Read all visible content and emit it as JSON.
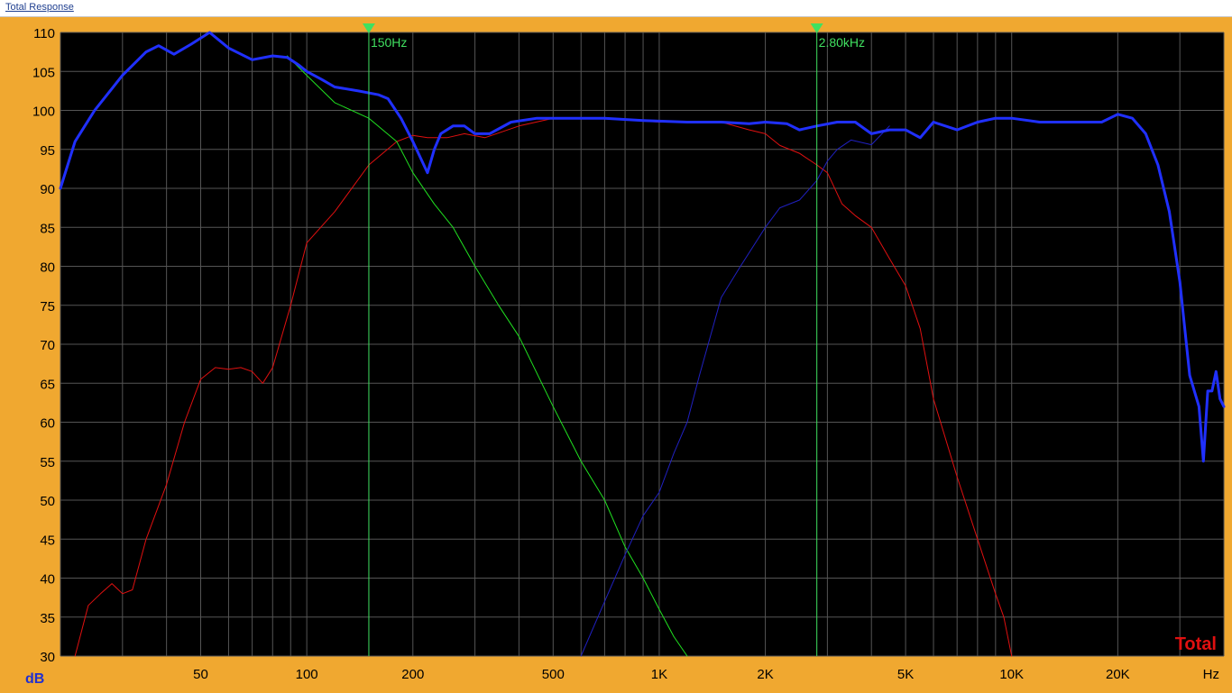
{
  "window": {
    "title": "Total Response"
  },
  "chart_data": {
    "type": "line",
    "title": "",
    "xlabel": "Hz",
    "ylabel": "dB",
    "x_scale": "log",
    "xlim": [
      20,
      40000
    ],
    "ylim": [
      30,
      110
    ],
    "grid": true,
    "x_ticks": [
      {
        "value": 50,
        "label": "50"
      },
      {
        "value": 100,
        "label": "100"
      },
      {
        "value": 200,
        "label": "200"
      },
      {
        "value": 500,
        "label": "500"
      },
      {
        "value": 1000,
        "label": "1K"
      },
      {
        "value": 2000,
        "label": "2K"
      },
      {
        "value": 5000,
        "label": "5K"
      },
      {
        "value": 10000,
        "label": "10K"
      },
      {
        "value": 20000,
        "label": "20K"
      }
    ],
    "y_ticks": [
      {
        "value": 110,
        "label": "110"
      },
      {
        "value": 105,
        "label": "105"
      },
      {
        "value": 100,
        "label": "100"
      },
      {
        "value": 95,
        "label": "95"
      },
      {
        "value": 90,
        "label": "90"
      },
      {
        "value": 85,
        "label": "85"
      },
      {
        "value": 80,
        "label": "80"
      },
      {
        "value": 75,
        "label": "75"
      },
      {
        "value": 70,
        "label": "70"
      },
      {
        "value": 65,
        "label": "65"
      },
      {
        "value": 60,
        "label": "60"
      },
      {
        "value": 55,
        "label": "55"
      },
      {
        "value": 50,
        "label": "50"
      },
      {
        "value": 45,
        "label": "45"
      },
      {
        "value": 40,
        "label": "40"
      },
      {
        "value": 35,
        "label": "35"
      },
      {
        "value": 30,
        "label": "30"
      }
    ],
    "cursors": [
      {
        "frequency": 150,
        "label": "150Hz",
        "color": "#40e060"
      },
      {
        "frequency": 2800,
        "label": "2.80kHz",
        "color": "#40e060"
      }
    ],
    "annotation": {
      "text": "Total",
      "color": "#e01010"
    },
    "colors": {
      "plot_background": "#000000",
      "frame": "#f0a830",
      "grid": "#555555",
      "cursor": "#40e060"
    },
    "series": [
      {
        "color": "#2030ff",
        "width": 3,
        "x": [
          20,
          22,
          25,
          30,
          35,
          38,
          42,
          47,
          53,
          60,
          70,
          80,
          88,
          95,
          100,
          110,
          120,
          140,
          160,
          170,
          185,
          200,
          220,
          230,
          240,
          260,
          280,
          300,
          330,
          380,
          450,
          550,
          700,
          900,
          1200,
          1500,
          1800,
          2000,
          2300,
          2500,
          2800,
          3200,
          3600,
          4000,
          4500,
          5000,
          5500,
          6000,
          7000,
          8000,
          9000,
          10000,
          12000,
          15000,
          18000,
          20000,
          22000,
          24000,
          26000,
          28000,
          30000,
          32000,
          34000,
          35000,
          36000,
          37000,
          38000,
          39000,
          40000
        ],
        "values": [
          90,
          96,
          100,
          104.5,
          107.5,
          108.3,
          107.2,
          108.5,
          110,
          108,
          106.5,
          107,
          106.8,
          105.8,
          105,
          104,
          103,
          102.5,
          102,
          101.5,
          99,
          96,
          92,
          95,
          97,
          98,
          98,
          97,
          97,
          98.5,
          99,
          99,
          99,
          98.7,
          98.5,
          98.5,
          98.3,
          98.5,
          98.3,
          97.5,
          98,
          98.5,
          98.5,
          97,
          97.5,
          97.5,
          96.5,
          98.5,
          97.5,
          98.5,
          99,
          99,
          98.5,
          98.5,
          98.5,
          99.5,
          99,
          97,
          93,
          87,
          78,
          66,
          62,
          55,
          64,
          64,
          66.5,
          63,
          62
        ]
      },
      {
        "color": "#20e020",
        "width": 1,
        "x": [
          88,
          100,
          120,
          150,
          180,
          200,
          230,
          260,
          300,
          350,
          400,
          500,
          600,
          700,
          800,
          900,
          1000,
          1100,
          1200
        ],
        "values": [
          107,
          104.5,
          101,
          99,
          96,
          92,
          88,
          85,
          80,
          75,
          71,
          62,
          55,
          50,
          44,
          40,
          36,
          32.5,
          30
        ]
      },
      {
        "color": "#e01010",
        "width": 1,
        "x": [
          22,
          24,
          26,
          28,
          30,
          32,
          35,
          40,
          45,
          50,
          55,
          60,
          65,
          70,
          75,
          80,
          90,
          100,
          120,
          150,
          180,
          200,
          220,
          250,
          280,
          320,
          400,
          500,
          700,
          1000,
          1500,
          1800,
          2000,
          2200,
          2500,
          2800,
          3000,
          3300,
          3600,
          4000,
          4500,
          5000,
          5500,
          6000,
          7000,
          8000,
          9000,
          9500,
          10000
        ],
        "values": [
          30,
          36.5,
          38,
          39.3,
          38,
          38.5,
          45,
          52,
          60,
          65.5,
          67,
          66.8,
          67,
          66.5,
          65,
          67,
          75,
          83,
          87,
          93,
          96,
          96.8,
          96.5,
          96.5,
          97,
          96.5,
          98,
          99,
          99,
          98.5,
          98.5,
          97.5,
          97,
          95.5,
          94.5,
          93,
          92,
          88,
          86.5,
          85,
          81,
          77.5,
          72,
          63,
          53,
          45,
          38,
          35,
          30
        ]
      },
      {
        "color": "#2020c0",
        "width": 1,
        "x": [
          600,
          700,
          800,
          900,
          1000,
          1100,
          1200,
          1300,
          1500,
          1700,
          2000,
          2200,
          2500,
          2800,
          3000,
          3200,
          3500,
          4000,
          4500
        ],
        "values": [
          30,
          37,
          43,
          48,
          51,
          56,
          60,
          66,
          76,
          80,
          85,
          87.5,
          88.5,
          91,
          93.5,
          95,
          96.2,
          95.6,
          98
        ]
      }
    ]
  }
}
